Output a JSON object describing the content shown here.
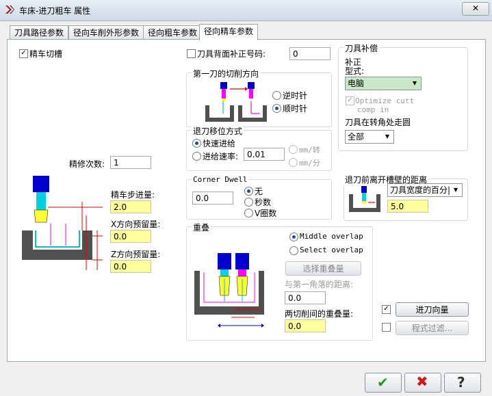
{
  "window": {
    "title": "车床-进刀粗车 属性",
    "close_label": "✕"
  },
  "tabs": [
    {
      "label": "刀具路径参数"
    },
    {
      "label": "径向车削外形参数"
    },
    {
      "label": "径向粗车参数"
    },
    {
      "label": "径向精车参数"
    }
  ],
  "left": {
    "finish_groove_label": "精车切槽",
    "finish_count_label": "精修次数:",
    "finish_count_value": "1",
    "finish_step_label": "精车步进量:",
    "finish_step_value": "2.0",
    "x_stock_label": "X方向预留量:",
    "x_stock_value": "0.0",
    "z_stock_label": "Z方向预留量:",
    "z_stock_value": "0.0"
  },
  "back_comp": {
    "label": "刀具背面补正号码:",
    "value": "0"
  },
  "first_cut": {
    "title": "第一刀的切削方向",
    "ccw_label": "逆时针",
    "cw_label": "顺时针"
  },
  "retract": {
    "title": "退刀移位方式",
    "rapid_label": "快速进给",
    "feed_label": "进给速率:",
    "feed_value": "0.01",
    "mm_per_rev": "mm/转",
    "mm_per_min": "mm/分"
  },
  "tool_comp": {
    "title": "刀具补偿",
    "type_label_1": "补正",
    "type_label_2": "型式:",
    "type_value": "电脑",
    "optimize_label_1": "Optimize cutt",
    "optimize_label_2": "comp in",
    "corner_label": "刀具在转角处走圆",
    "corner_value": "全部"
  },
  "corner_dwell": {
    "title": "Corner Dwell",
    "value": "0.0",
    "none_label": "无",
    "seconds_label": "秒数",
    "rev_label": "V圈数"
  },
  "groove_clear": {
    "title": "退刀前离开槽壁的距离",
    "mode_value": "刀具宽度的百分|",
    "value": "5.0"
  },
  "overlap": {
    "title": "重叠",
    "middle_label": "Middle overlap",
    "select_label": "Select overlap",
    "select_button": "选择重叠量",
    "first_corner_label": "与第一角落的距离:",
    "first_corner_value": "0.0",
    "between_label": "两切削间的重叠量:",
    "between_value": "0.0"
  },
  "side_buttons": {
    "lead_in": "进刀向量",
    "filter": "程式过滤..."
  },
  "footer": {
    "ok": "✔",
    "cancel": "✖",
    "help": "?"
  },
  "colors": {
    "input_highlight": "#ffff9e",
    "tool_blue": "#0000cc",
    "tool_yellow": "#ffff33",
    "part_gray": "#505050"
  }
}
